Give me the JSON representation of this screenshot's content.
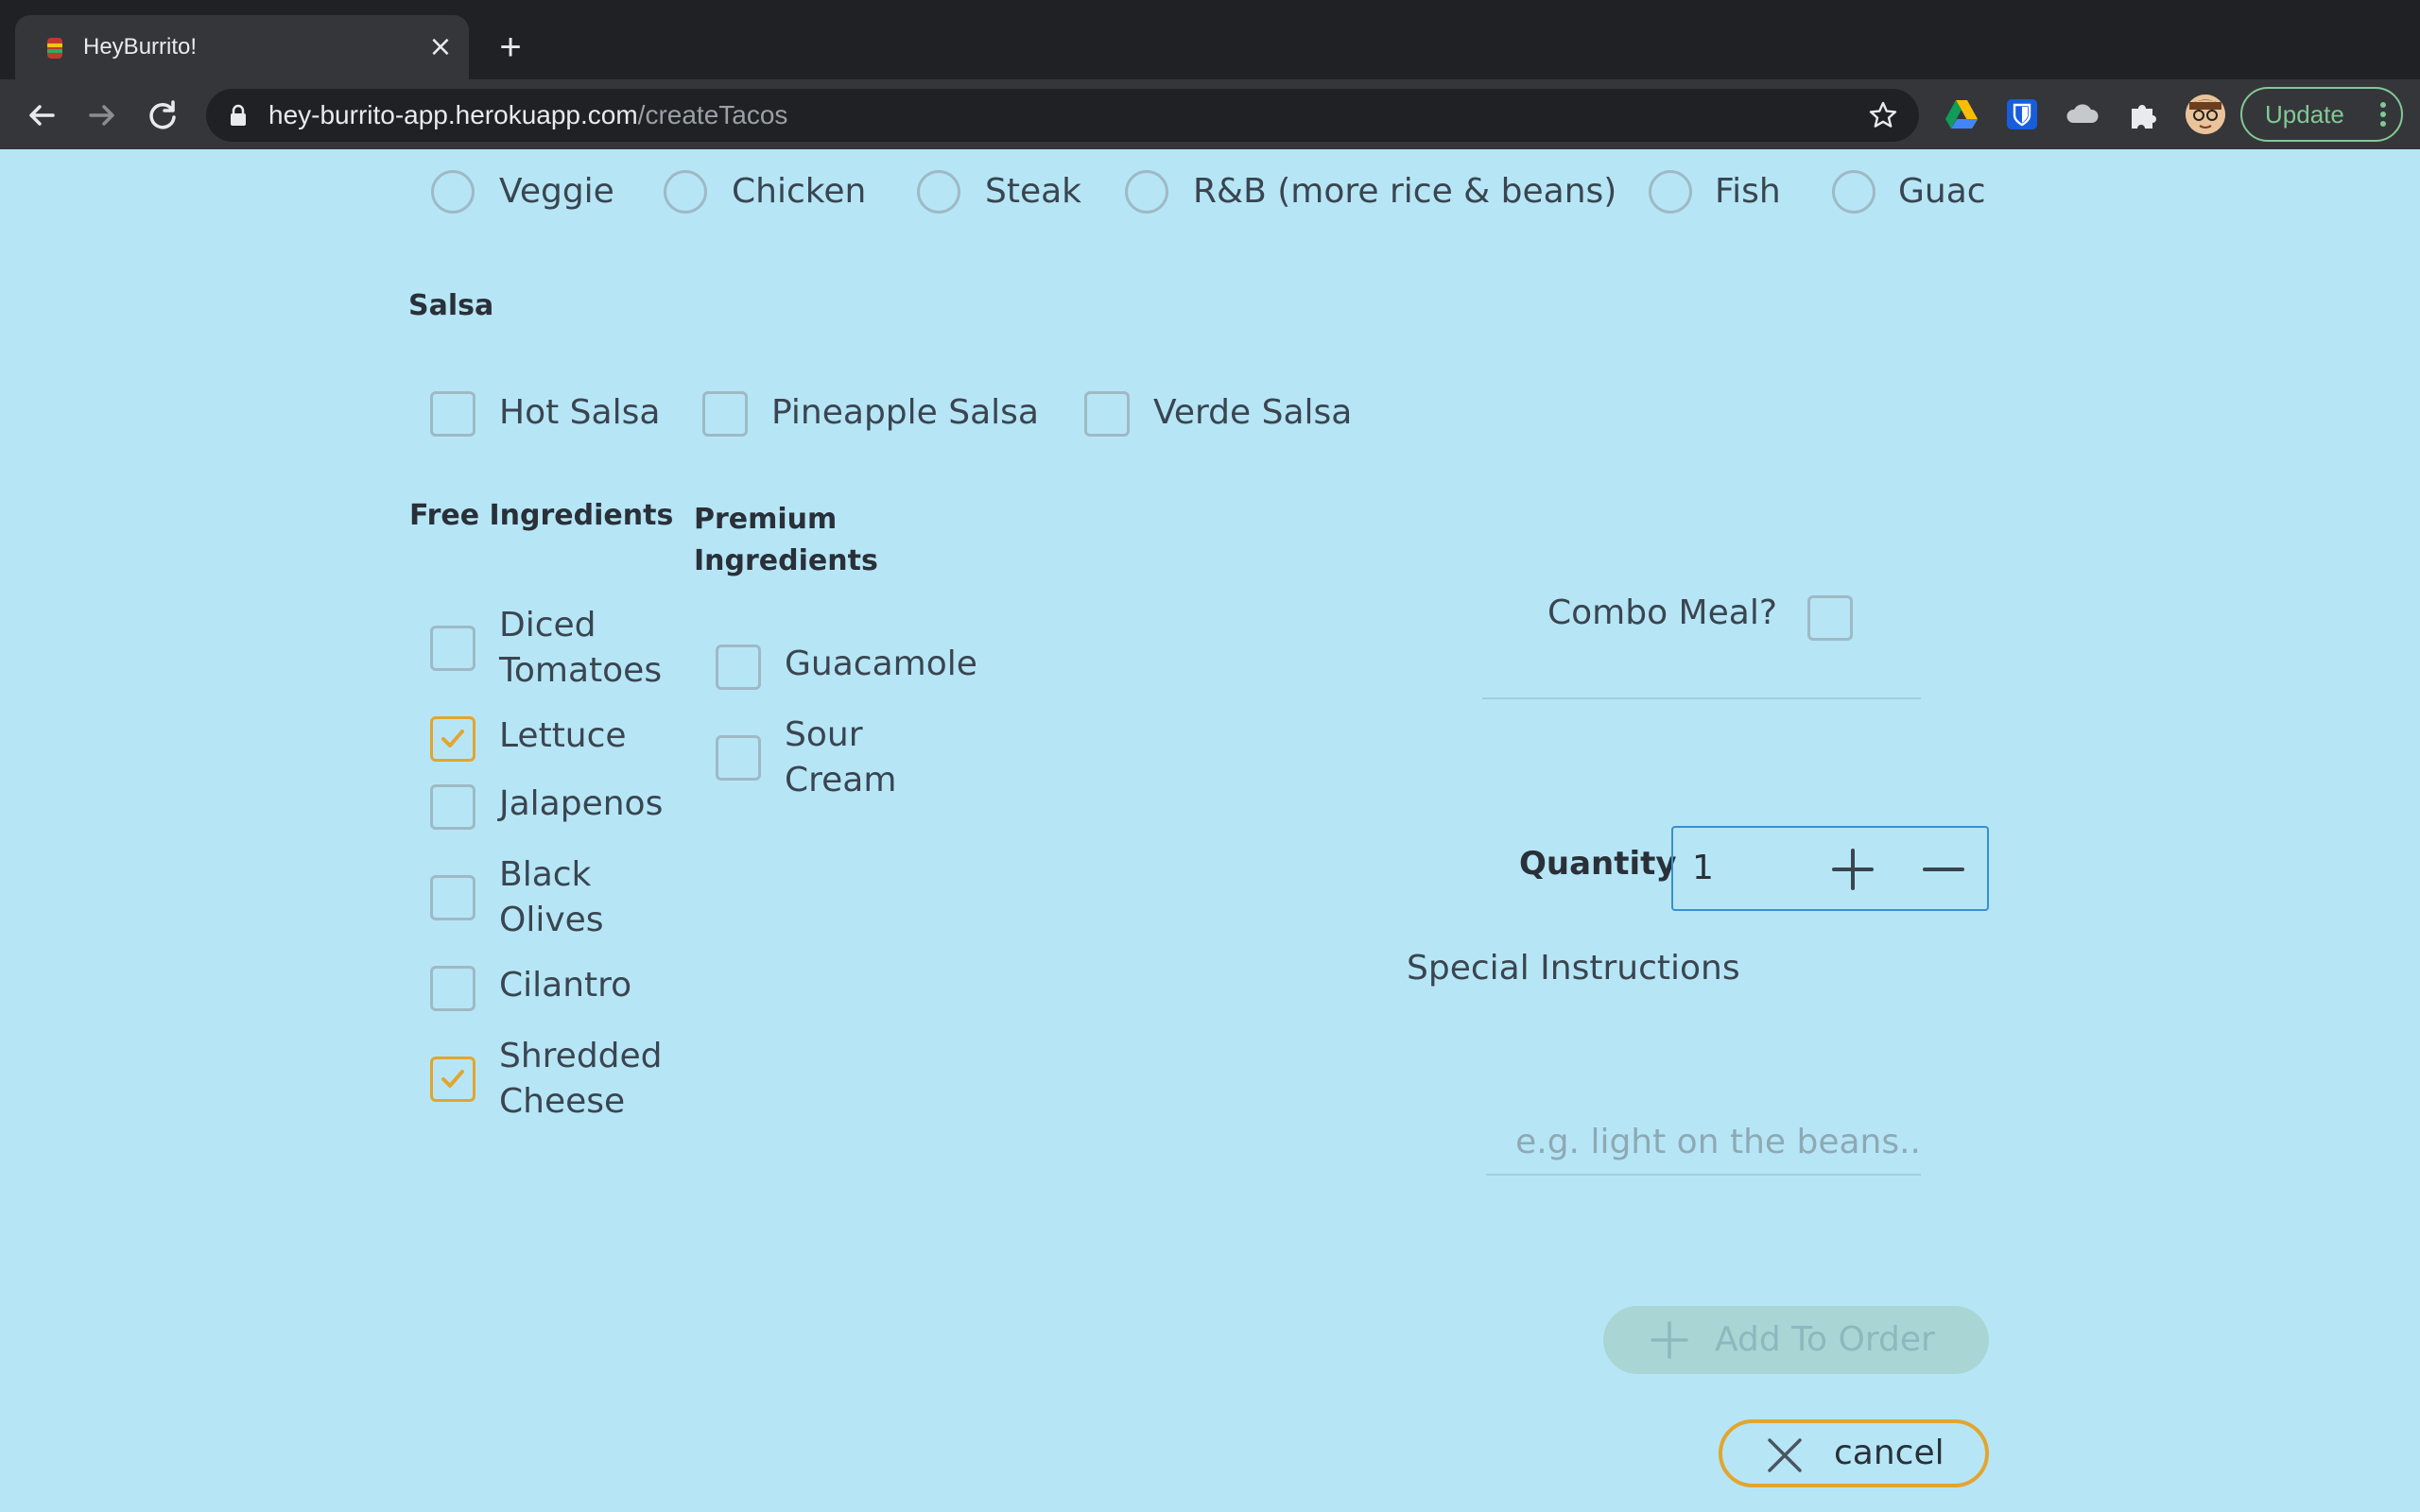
{
  "browser": {
    "tab_title": "HeyBurrito!",
    "url_host": "hey-burrito-app.herokuapp.com",
    "url_path": "/createTacos",
    "update_label": "Update"
  },
  "protein_options": [
    {
      "label": "Veggie"
    },
    {
      "label": "Chicken"
    },
    {
      "label": "Steak"
    },
    {
      "label": "R&B (more rice & beans)"
    },
    {
      "label": "Fish"
    },
    {
      "label": "Guac"
    }
  ],
  "salsa": {
    "title": "Salsa",
    "options": [
      {
        "label": "Hot Salsa",
        "checked": false
      },
      {
        "label": "Pineapple Salsa",
        "checked": false
      },
      {
        "label": "Verde Salsa",
        "checked": false
      }
    ]
  },
  "free_ingredients": {
    "title": "Free Ingredients",
    "options": [
      {
        "label": "Diced Tomatoes",
        "checked": false
      },
      {
        "label": "Lettuce",
        "checked": true
      },
      {
        "label": "Jalapenos",
        "checked": false
      },
      {
        "label": "Black Olives",
        "checked": false
      },
      {
        "label": "Cilantro",
        "checked": false
      },
      {
        "label": "Shredded Cheese",
        "checked": true
      }
    ]
  },
  "premium_ingredients": {
    "title": "Premium Ingredients",
    "options": [
      {
        "label": "Guacamole",
        "checked": false
      },
      {
        "label": "Sour Cream",
        "checked": false
      }
    ]
  },
  "combo": {
    "label": "Combo Meal?",
    "checked": false
  },
  "quantity": {
    "label": "Quantity",
    "value": "1"
  },
  "instructions": {
    "label": "Special Instructions",
    "placeholder": "e.g. light on the beans.."
  },
  "actions": {
    "add_label": "Add To Order",
    "cancel_label": "cancel"
  },
  "colors": {
    "page_bg": "#b6e6f6",
    "accent": "#e3a52d",
    "add_btn_bg": "#a9d6d4",
    "focus_border": "#3a8ed0"
  }
}
